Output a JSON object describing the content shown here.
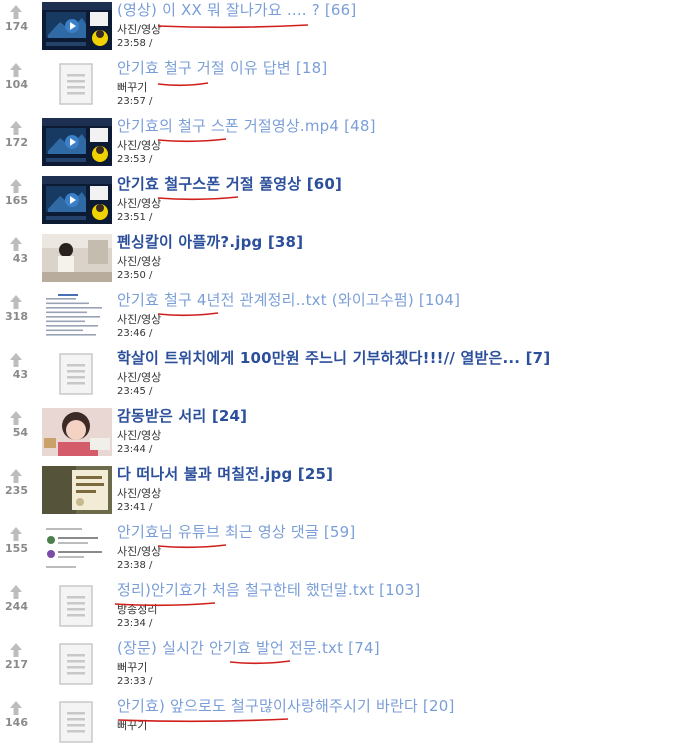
{
  "posts": [
    {
      "votes": "174",
      "title": "(영상) 이 XX 뭐 잘나가요 .... ? [66]",
      "category": "사진/영상",
      "time": "23:58 /",
      "thumb": "video",
      "visited": false
    },
    {
      "votes": "104",
      "title": "안기효 철구 거절 이유 답변 [18]",
      "category": "뻐꾸기",
      "time": "23:57 /",
      "thumb": "doc",
      "visited": false
    },
    {
      "votes": "172",
      "title": "안기효의 철구 스폰 거절영상.mp4 [48]",
      "category": "사진/영상",
      "time": "23:53 /",
      "thumb": "video",
      "visited": false
    },
    {
      "votes": "165",
      "title": "안기효 철구스폰 거절 풀영상 [60]",
      "category": "사진/영상",
      "time": "23:51 /",
      "thumb": "video",
      "visited": true
    },
    {
      "votes": "43",
      "title": "펜싱칼이 아플까?.jpg [38]",
      "category": "사진/영상",
      "time": "23:50 /",
      "thumb": "photo-room",
      "visited": true
    },
    {
      "votes": "318",
      "title": "안기효 철구 4년전 관계정리..txt (와이고수펌) [104]",
      "category": "사진/영상",
      "time": "23:46 /",
      "thumb": "text-shot",
      "visited": false
    },
    {
      "votes": "43",
      "title": "학살이 트위치에게 100만원 주느니 기부하겠다!!!// 열받은... [7]",
      "category": "사진/영상",
      "time": "23:45 /",
      "thumb": "doc",
      "visited": true
    },
    {
      "votes": "54",
      "title": "감동받은 서리 [24]",
      "category": "사진/영상",
      "time": "23:44 /",
      "thumb": "photo-girl",
      "visited": true
    },
    {
      "votes": "235",
      "title": "다 떠나서 불과 며칠전.jpg [25]",
      "category": "사진/영상",
      "time": "23:41 /",
      "thumb": "photo-text",
      "visited": true
    },
    {
      "votes": "155",
      "title": "안기효님 유튜브 최근 영상 댓글 [59]",
      "category": "사진/영상",
      "time": "23:38 /",
      "thumb": "comments",
      "visited": false
    },
    {
      "votes": "244",
      "title": "정리)안기효가 처음 철구한테 했던말.txt [103]",
      "category": "방송정리",
      "time": "23:34 /",
      "thumb": "doc",
      "visited": false
    },
    {
      "votes": "217",
      "title": "(장문) 실시간 안기효 발언 전문.txt [74]",
      "category": "뻐꾸기",
      "time": "23:33 /",
      "thumb": "doc",
      "visited": false
    },
    {
      "votes": "146",
      "title": "안기효) 앞으로도 철구많이사랑해주시기 바란다 [20]",
      "category": "뻐꾸기",
      "time": "",
      "thumb": "doc",
      "visited": false
    }
  ],
  "annotation_color": "#d0201c"
}
